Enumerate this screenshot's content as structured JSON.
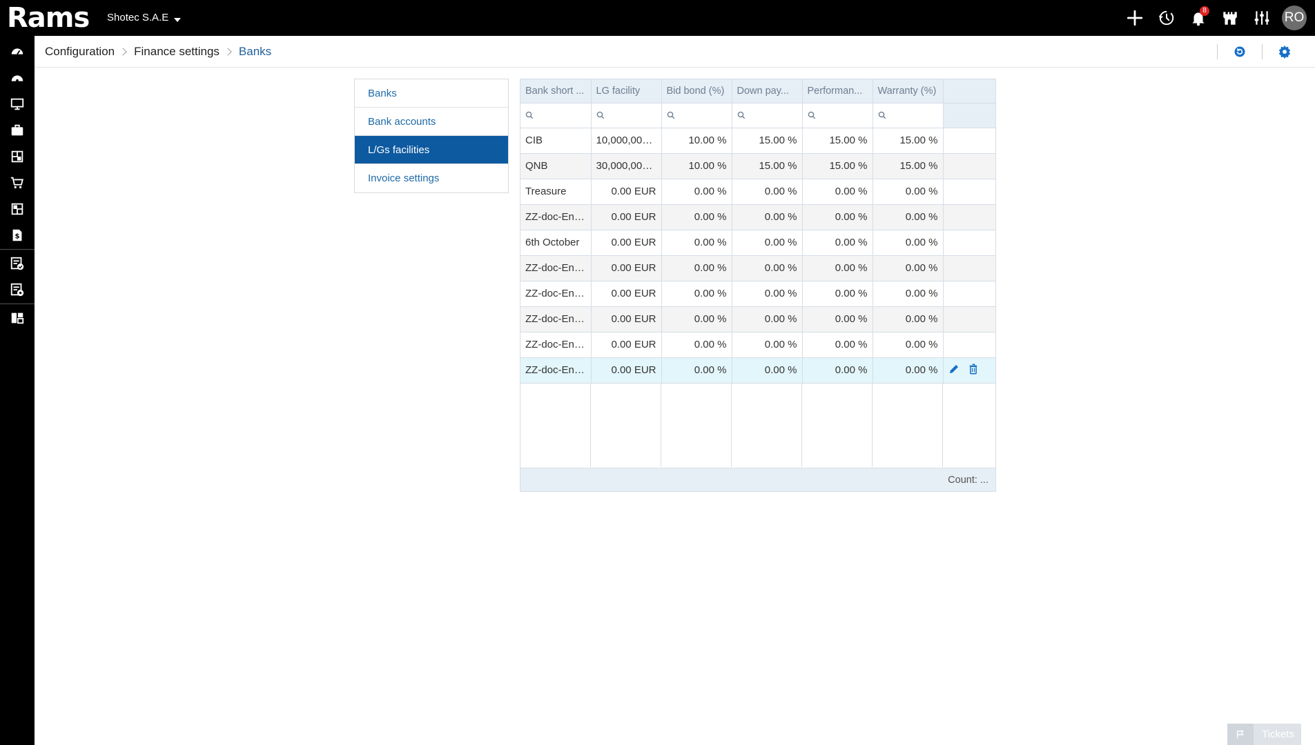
{
  "app": {
    "logo_text": "Rams",
    "company": "Shotec S.A.E",
    "notification_count": "8",
    "user_initials": "RO"
  },
  "breadcrumb": [
    {
      "label": "Configuration"
    },
    {
      "label": "Finance settings"
    },
    {
      "label": "Banks"
    }
  ],
  "menu": [
    {
      "label": "Banks",
      "selected": false
    },
    {
      "label": "Bank accounts",
      "selected": false
    },
    {
      "label": "L/Gs facilities",
      "selected": true
    },
    {
      "label": "Invoice settings",
      "selected": false
    }
  ],
  "grid": {
    "columns": [
      "Bank short ...",
      "LG facility",
      "Bid bond (%)",
      "Down pay...",
      "Performan...",
      "Warranty (%)"
    ],
    "rows": [
      [
        "CIB",
        "10,000,000....",
        "10.00 %",
        "15.00 %",
        "15.00 %",
        "15.00 %"
      ],
      [
        "QNB",
        "30,000,000....",
        "10.00 %",
        "15.00 %",
        "15.00 %",
        "15.00 %"
      ],
      [
        "Treasure",
        "0.00 EUR",
        "0.00 %",
        "0.00 %",
        "0.00 %",
        "0.00 %"
      ],
      [
        "ZZ-doc-Ent...",
        "0.00 EUR",
        "0.00 %",
        "0.00 %",
        "0.00 %",
        "0.00 %"
      ],
      [
        "6th October",
        "0.00 EUR",
        "0.00 %",
        "0.00 %",
        "0.00 %",
        "0.00 %"
      ],
      [
        "ZZ-doc-Ent...",
        "0.00 EUR",
        "0.00 %",
        "0.00 %",
        "0.00 %",
        "0.00 %"
      ],
      [
        "ZZ-doc-Ent...",
        "0.00 EUR",
        "0.00 %",
        "0.00 %",
        "0.00 %",
        "0.00 %"
      ],
      [
        "ZZ-doc-Ent...",
        "0.00 EUR",
        "0.00 %",
        "0.00 %",
        "0.00 %",
        "0.00 %"
      ],
      [
        "ZZ-doc-Ent...",
        "0.00 EUR",
        "0.00 %",
        "0.00 %",
        "0.00 %",
        "0.00 %"
      ],
      [
        "ZZ-doc-Ent...",
        "0.00 EUR",
        "0.00 %",
        "0.00 %",
        "0.00 %",
        "0.00 %"
      ]
    ],
    "selected_row": 9,
    "footer": "Count: ..."
  },
  "tickets": {
    "label": "Tickets"
  },
  "colors": {
    "accent": "#0d5aa0",
    "link": "#1f6aa8",
    "action_blue": "#1570c8",
    "badge_red": "#e02424",
    "selected_row": "#e3f6fb"
  },
  "icons": {
    "top": [
      "plus-icon",
      "history-icon",
      "bell-icon",
      "castle-icon",
      "sliders-icon"
    ],
    "side": [
      "dashboard-icon",
      "dashboard-alt-icon",
      "monitor-icon",
      "briefcase-icon",
      "modules-icon",
      "cart-icon",
      "modules-alt-icon",
      "invoice-dollar-icon",
      "document-check-icon",
      "document-settings-icon",
      "layout-icon"
    ],
    "breadcrumb_actions": [
      "refresh-icon",
      "gear-icon"
    ]
  }
}
